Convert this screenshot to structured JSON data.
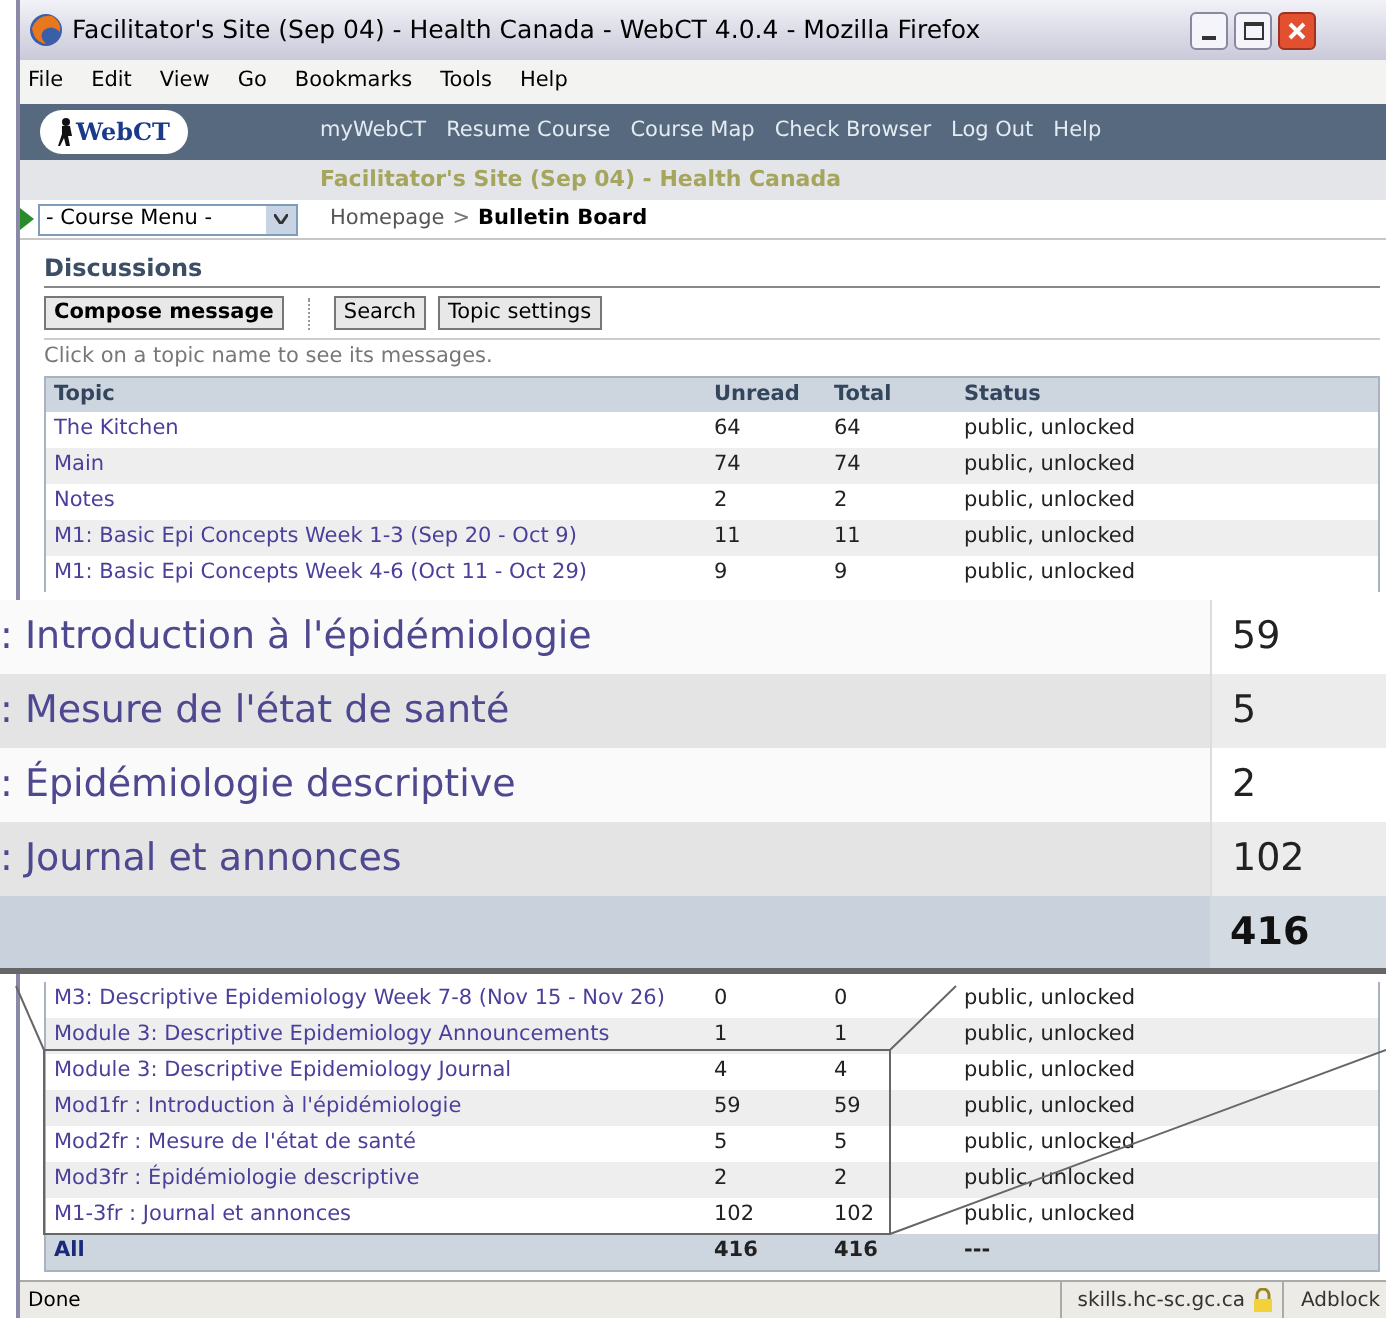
{
  "window": {
    "title": "Facilitator's Site (Sep 04) - Health Canada - WebCT 4.0.4 - Mozilla Firefox"
  },
  "menu": [
    "File",
    "Edit",
    "View",
    "Go",
    "Bookmarks",
    "Tools",
    "Help"
  ],
  "nav": {
    "logo": "WebCT",
    "links": [
      "myWebCT",
      "Resume Course",
      "Course Map",
      "Check Browser",
      "Log Out",
      "Help"
    ]
  },
  "site_title": "Facilitator's Site (Sep 04) - Health Canada",
  "course_menu": {
    "value": "- Course Menu -"
  },
  "breadcrumb": {
    "separator": ">",
    "items": [
      {
        "label": "Homepage",
        "current": false
      },
      {
        "label": "Bulletin Board",
        "current": true
      }
    ]
  },
  "heading": "Discussions",
  "buttons": [
    {
      "label": "Compose message",
      "primary": true
    },
    {
      "label": "Search",
      "primary": false
    },
    {
      "label": "Topic settings",
      "primary": false
    }
  ],
  "hint": "Click on a topic name to see its messages.",
  "table": {
    "columns": [
      "Topic",
      "Unread",
      "Total",
      "Status"
    ],
    "rows_top": [
      {
        "topic": "The Kitchen",
        "unread": "64",
        "total": "64",
        "status": "public, unlocked"
      },
      {
        "topic": "Main",
        "unread": "74",
        "total": "74",
        "status": "public, unlocked"
      },
      {
        "topic": "Notes",
        "unread": "2",
        "total": "2",
        "status": "public, unlocked"
      },
      {
        "topic": "M1: Basic Epi Concepts Week 1-3 (Sep 20 - Oct 9)",
        "unread": "11",
        "total": "11",
        "status": "public, unlocked"
      },
      {
        "topic": "M1: Basic Epi Concepts Week 4-6 (Oct 11 - Oct 29)",
        "unread": "9",
        "total": "9",
        "status": "public, unlocked"
      }
    ],
    "rows_bottom": [
      {
        "topic": "M3: Descriptive Epidemiology Week 7-8 (Nov 15 - Nov 26)",
        "unread": "0",
        "total": "0",
        "status": "public, unlocked"
      },
      {
        "topic": "Module 3: Descriptive Epidemiology Announcements",
        "unread": "1",
        "total": "1",
        "status": "public, unlocked"
      },
      {
        "topic": "Module 3: Descriptive Epidemiology Journal",
        "unread": "4",
        "total": "4",
        "status": "public, unlocked"
      },
      {
        "topic": "Mod1fr : Introduction à l'épidémiologie",
        "unread": "59",
        "total": "59",
        "status": "public, unlocked"
      },
      {
        "topic": "Mod2fr : Mesure de l'état de santé",
        "unread": "5",
        "total": "5",
        "status": "public, unlocked"
      },
      {
        "topic": "Mod3fr : Épidémiologie descriptive",
        "unread": "2",
        "total": "2",
        "status": "public, unlocked"
      },
      {
        "topic": "M1-3fr : Journal et annonces",
        "unread": "102",
        "total": "102",
        "status": "public, unlocked"
      }
    ],
    "total_row": {
      "topic": "All",
      "unread": "416",
      "total": "416",
      "status": "---"
    }
  },
  "magnified": {
    "rows": [
      {
        "topic": ": Introduction à l'épidémiologie",
        "count": "59"
      },
      {
        "topic": ": Mesure de l'état de santé",
        "count": "5"
      },
      {
        "topic": ": Épidémiologie descriptive",
        "count": "2"
      },
      {
        "topic": ": Journal et annonces",
        "count": "102"
      }
    ],
    "total": "416"
  },
  "status_bar": {
    "text": "Done",
    "host": "skills.hc-sc.gc.ca",
    "addon": "Adblock"
  }
}
